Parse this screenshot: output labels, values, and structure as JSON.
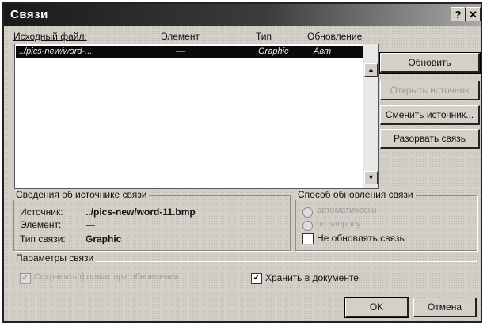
{
  "window": {
    "title": "Связи",
    "help_glyph": "?",
    "close_glyph": "✕"
  },
  "list": {
    "headers": {
      "source": "Исходный файл:",
      "element": "Элемент",
      "type": "Тип",
      "update": "Обновление"
    },
    "rows": [
      {
        "source": "../pics-new/word-...",
        "element": "—",
        "type": "Graphic",
        "update": "Авт"
      }
    ],
    "scroll_up": "▲",
    "scroll_down": "▼"
  },
  "buttons": {
    "update": "Обновить",
    "open_source": "Открыть источник",
    "change_source": "Сменить источник...",
    "break_link": "Разорвать связь",
    "ok": "OK",
    "cancel": "Отмена"
  },
  "source_info": {
    "group_title": "Сведения об источнике связи",
    "source_label": "Источник:",
    "source_value": "../pics-new/word-11.bmp",
    "element_label": "Элемент:",
    "element_value": "—",
    "type_label": "Тип связи:",
    "type_value": "Graphic"
  },
  "update_method": {
    "group_title": "Способ обновления связи",
    "auto": "автоматически",
    "on_request": "по запросу",
    "dont_update": "Не обновлять связь",
    "dont_update_checked": false
  },
  "link_params": {
    "group_title": "Параметры связи",
    "keep_format": "Сохранять формат при обновлении",
    "keep_format_checked": true,
    "store_in_doc": "Хранить в документе",
    "store_in_doc_checked": true,
    "check_mark": "✓"
  }
}
